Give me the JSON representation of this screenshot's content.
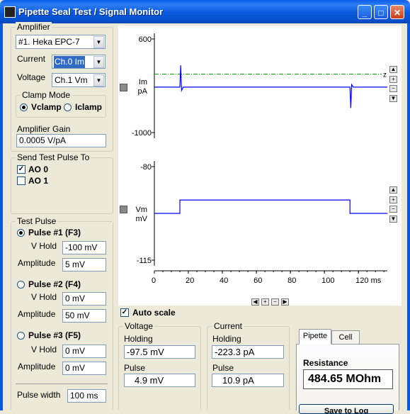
{
  "window": {
    "title": "Pipette Seal Test / Signal Monitor"
  },
  "amplifier": {
    "group_label": "Amplifier",
    "model": "#1. Heka EPC-7",
    "current_label": "Current",
    "current_value": "Ch.0 Im",
    "voltage_label": "Voltage",
    "voltage_value": "Ch.1 Vm",
    "clamp_mode": {
      "label": "Clamp Mode",
      "vclamp": "Vclamp",
      "iclamp": "Iclamp",
      "selected": "Vclamp"
    },
    "gain_label": "Amplifier Gain",
    "gain_value": "0.0005 V/pA"
  },
  "send_pulse": {
    "label": "Send Test Pulse To",
    "ao0": "AO 0",
    "ao0_checked": true,
    "ao1": "AO 1",
    "ao1_checked": false
  },
  "test_pulse": {
    "label": "Test Pulse",
    "pulses": [
      {
        "name": "Pulse #1 (F3)",
        "hold_label": "V Hold",
        "hold": "-100 mV",
        "amp_label": "Amplitude",
        "amp": "5 mV",
        "selected": true
      },
      {
        "name": "Pulse #2 (F4)",
        "hold_label": "V Hold",
        "hold": "0 mV",
        "amp_label": "Amplitude",
        "amp": "50 mV",
        "selected": false
      },
      {
        "name": "Pulse #3 (F5)",
        "hold_label": "V Hold",
        "hold": "0 mV",
        "amp_label": "Amplitude",
        "amp": "0 mV",
        "selected": false
      }
    ],
    "width_label": "Pulse width",
    "width": "100 ms"
  },
  "chart_data": [
    {
      "type": "line",
      "ylabel": "Im\npA",
      "ylabel_line1": "Im",
      "ylabel_line2": "pA",
      "ylim": [
        -1000,
        600
      ],
      "yticks": [
        "600",
        "-1000"
      ],
      "xlim": [
        0,
        137
      ],
      "zero_marker": "z",
      "series": [
        {
          "x": [
            0,
            15,
            15.5,
            16,
            17,
            115,
            115.5,
            116,
            117,
            137
          ],
          "y": [
            -223,
            -223,
            150,
            -280,
            -223,
            -223,
            -580,
            -180,
            -223,
            -223
          ]
        }
      ],
      "reference_line": 0,
      "reference_color": "#00a000"
    },
    {
      "type": "line",
      "ylabel_line1": "Vm",
      "ylabel_line2": "mV",
      "ylim": [
        -115,
        -80
      ],
      "yticks": [
        "-80",
        "-115"
      ],
      "xlim": [
        0,
        137
      ],
      "xticks": [
        "0",
        "20",
        "40",
        "60",
        "80",
        "100",
        "120 ms"
      ],
      "xtick_values": [
        0,
        20,
        40,
        60,
        80,
        100,
        120
      ],
      "series": [
        {
          "x": [
            0,
            15,
            15,
            115,
            115,
            137
          ],
          "y": [
            -97.5,
            -97.5,
            -92.5,
            -92.5,
            -97.5,
            -97.5
          ]
        }
      ]
    }
  ],
  "plot": {
    "trace_color": "#0000ff",
    "autoscale_label": "Auto scale",
    "autoscale_checked": true
  },
  "voltage_readout": {
    "label": "Voltage",
    "holding_label": "Holding",
    "holding": "-97.5 mV",
    "pulse_label": "Pulse",
    "pulse": "4.9 mV"
  },
  "current_readout": {
    "label": "Current",
    "holding_label": "Holding",
    "holding": "-223.3 pA",
    "pulse_label": "Pulse",
    "pulse": "10.9 pA"
  },
  "resistance": {
    "tabs": [
      "Pipette",
      "Cell"
    ],
    "active_tab": "Pipette",
    "label": "Resistance",
    "value": "484.65 MOhm"
  },
  "footer": {
    "save_label": "Save to Log"
  }
}
